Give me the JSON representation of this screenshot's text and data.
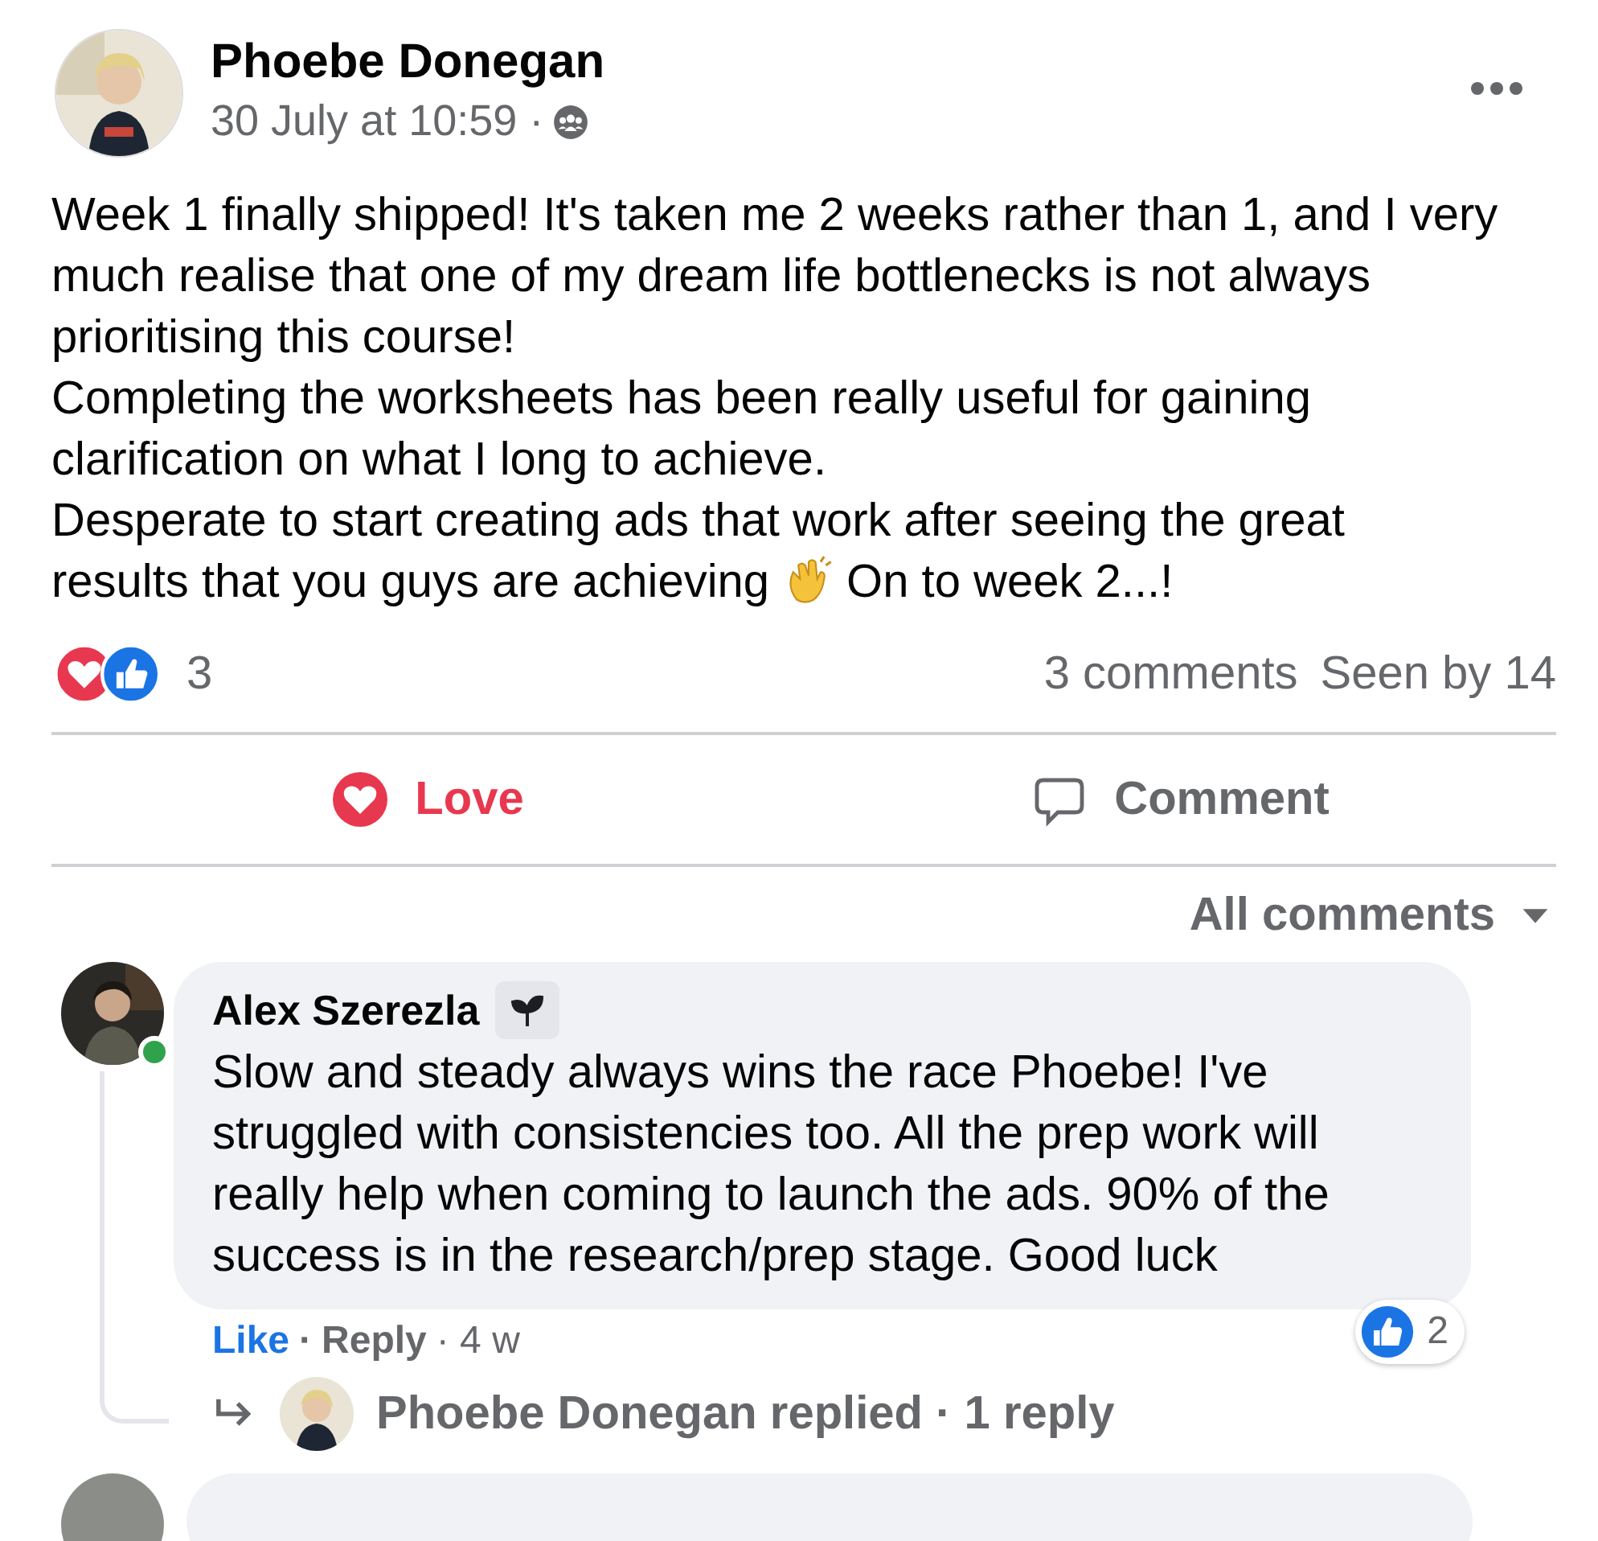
{
  "post": {
    "author": "Phoebe Donegan",
    "timestamp": "30 July at 10:59 ·",
    "paragraphs": [
      {
        "lines": [
          [
            "Week 1 finally shipped! It's taken me 2 weeks rather than 1, and I very much realise that one of my dream life bottlenecks is not always prioritising this course!"
          ]
        ]
      },
      {
        "lines": [
          [
            "Completing the worksheets has been really useful for gaining clarification on what I long to achieve."
          ]
        ]
      },
      {
        "lines": [
          [
            "Desperate to start creating ads that work after seeing the great"
          ],
          [
            "results that you guys are achieving",
            "On to week 2...!"
          ]
        ]
      }
    ],
    "reaction_count": "3",
    "comments_count": "3 comments",
    "seen_by": "Seen by 14"
  },
  "actions": [
    {
      "kind": "love",
      "label": "Love",
      "selected": true
    },
    {
      "kind": "comment",
      "label": "Comment",
      "selected": false
    }
  ],
  "comment_filter": "All comments",
  "comments": [
    {
      "author": "Alex Szerezla",
      "online": true,
      "text": "Slow and steady always wins the race Phoebe! I've struggled with consistencies too. All the prep work will really help when coming to launch the ads. 90% of the success is in the research/prep stage. Good luck",
      "like_label": "Like",
      "separator": "·",
      "reply_label": "Reply",
      "age": "· 4 w",
      "like_count": "2",
      "replies_summary": "Phoebe Donegan replied · 1 reply"
    }
  ]
}
